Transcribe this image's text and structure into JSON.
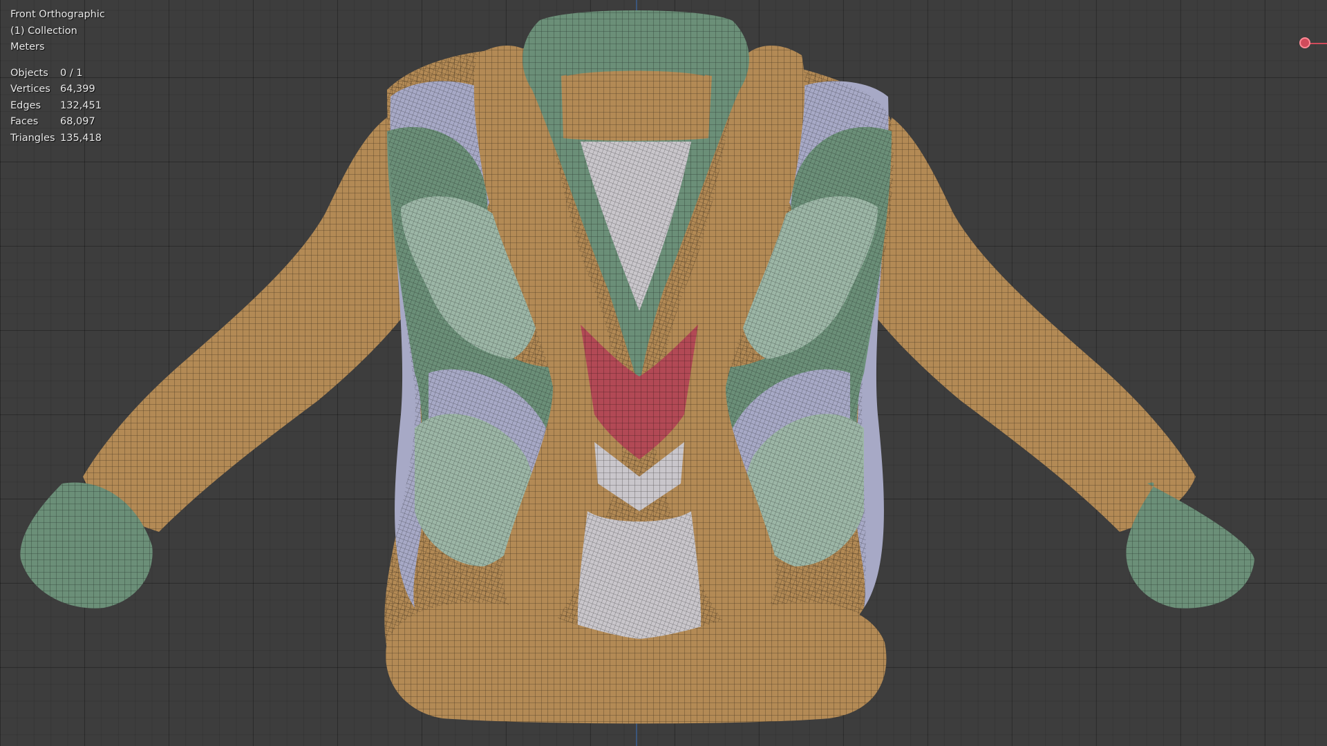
{
  "viewport": {
    "view_name": "Front Orthographic",
    "collection": "(1) Collection",
    "units": "Meters",
    "stats": [
      {
        "label": "Objects",
        "value": "0 / 1"
      },
      {
        "label": "Vertices",
        "value": "64,399"
      },
      {
        "label": "Edges",
        "value": "132,451"
      },
      {
        "label": "Faces",
        "value": "68,097"
      },
      {
        "label": "Triangles",
        "value": "135,418"
      }
    ]
  },
  "colors": {
    "background": "#3d3d3d",
    "orange": "#b38a55",
    "green": "#6b8f78",
    "light_green": "#9cb6a6",
    "lavender": "#a7a9c6",
    "pale": "#c9c6cb",
    "red": "#b24955",
    "axis_y": "#3b5a86",
    "axis_x": "#d04b5b"
  },
  "icons": {
    "gizmo": "x-axis-gizmo-icon"
  }
}
